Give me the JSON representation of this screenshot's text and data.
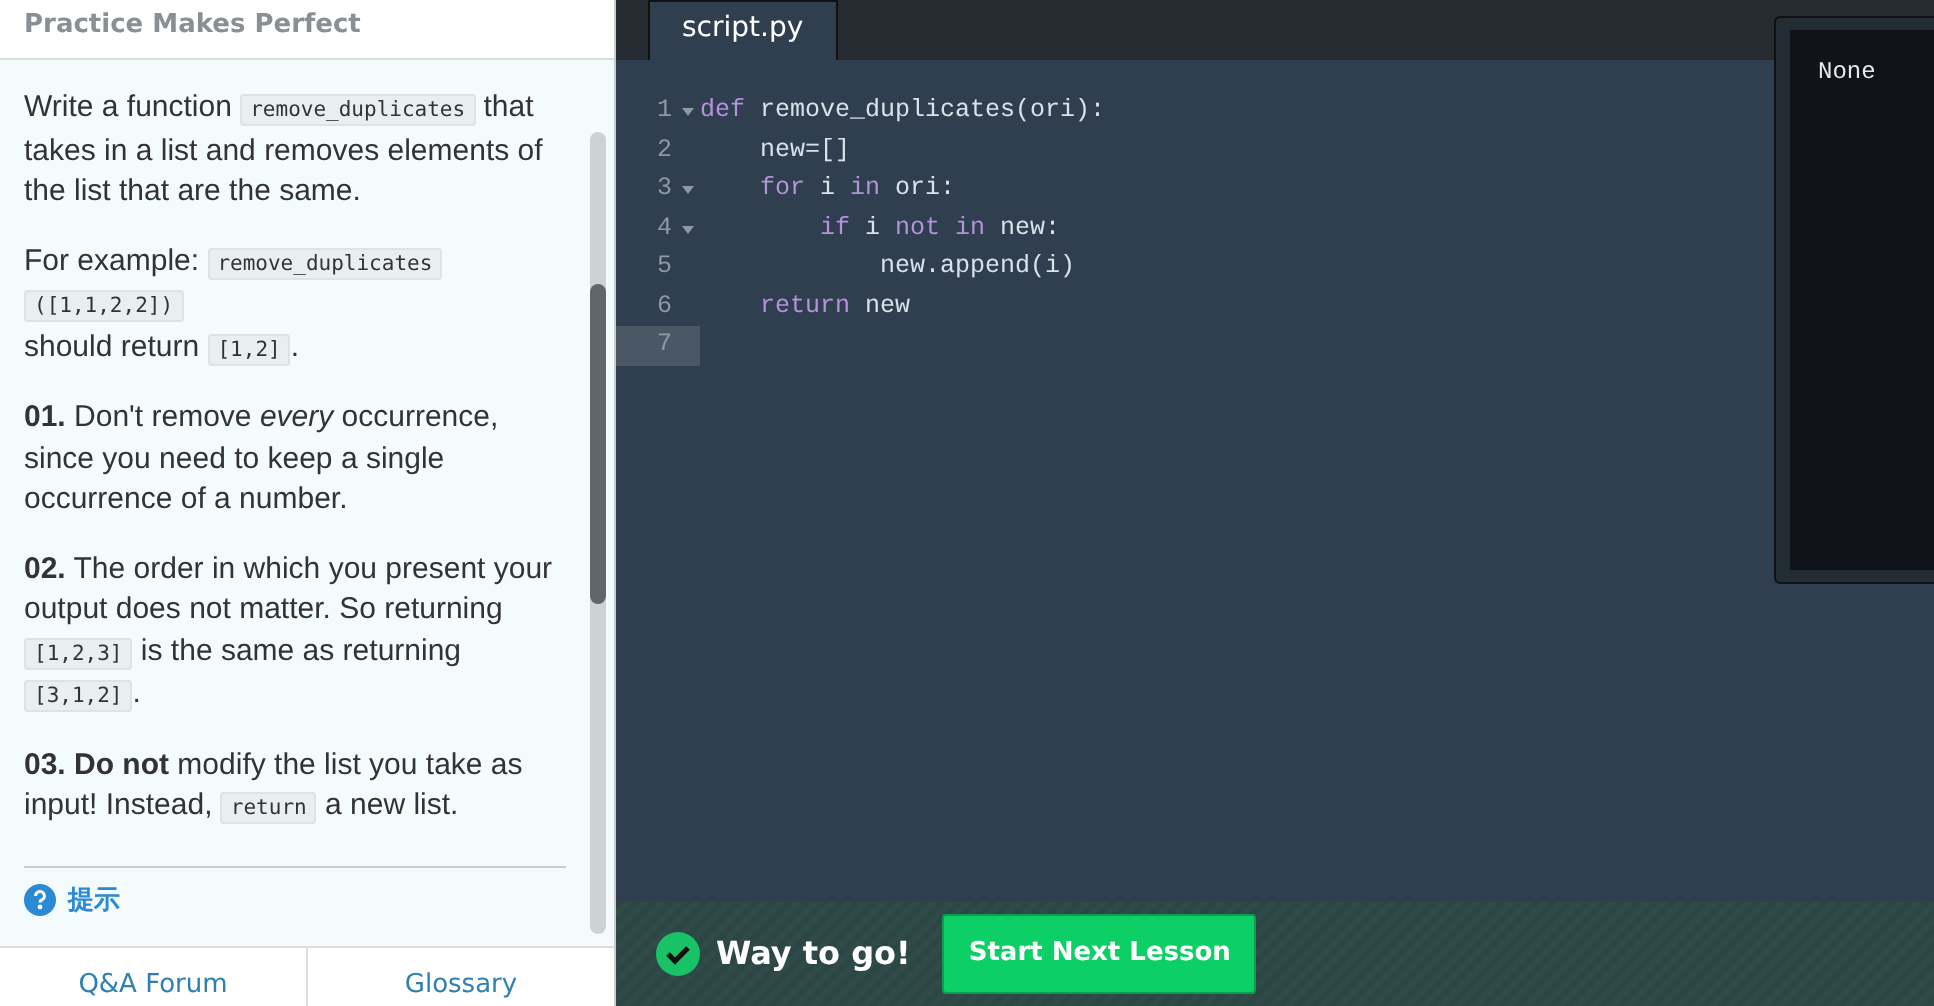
{
  "lesson": {
    "title": "Practice Makes Perfect",
    "paragraphs": [
      [
        {
          "kind": "text",
          "text": "Write a function "
        },
        {
          "kind": "code",
          "text": "remove_duplicates"
        },
        {
          "kind": "text",
          "text": " that takes in a list and removes elements of the list that are the same."
        }
      ],
      [
        {
          "kind": "text",
          "text": "For example: "
        },
        {
          "kind": "code",
          "text": "remove_duplicates"
        },
        {
          "kind": "space"
        },
        {
          "kind": "code",
          "text": "([1,1,2,2])"
        },
        {
          "kind": "break"
        },
        {
          "kind": "text",
          "text": "should return "
        },
        {
          "kind": "code",
          "text": "[1,2]"
        },
        {
          "kind": "text",
          "text": "."
        }
      ],
      [
        {
          "kind": "bold",
          "text": "01."
        },
        {
          "kind": "text",
          "text": " Don't remove "
        },
        {
          "kind": "italic",
          "text": "every"
        },
        {
          "kind": "text",
          "text": " occurrence, since you need to keep a single occurrence of a number."
        }
      ],
      [
        {
          "kind": "bold",
          "text": "02."
        },
        {
          "kind": "text",
          "text": " The order in which you present your output does not matter. So returning "
        },
        {
          "kind": "code",
          "text": "[1,2,3]"
        },
        {
          "kind": "text",
          "text": " is the same as returning "
        },
        {
          "kind": "code",
          "text": "[3,1,2]"
        },
        {
          "kind": "text",
          "text": "."
        }
      ],
      [
        {
          "kind": "bold",
          "text": "03. Do not"
        },
        {
          "kind": "text",
          "text": " modify the list you take as input! Instead, "
        },
        {
          "kind": "code",
          "text": "return"
        },
        {
          "kind": "text",
          "text": " a new list."
        }
      ]
    ],
    "hint": "提示",
    "footer_links": [
      "Q&A Forum",
      "Glossary"
    ]
  },
  "editor": {
    "tabs": [
      {
        "label": "script.py",
        "selected": true
      }
    ],
    "lines": [
      {
        "number": "1",
        "fold": true,
        "current": false,
        "tokens": [
          {
            "kind": "keyword",
            "text": "def"
          },
          {
            "kind": "plain",
            "text": " remove_duplicates(ori):"
          }
        ]
      },
      {
        "number": "2",
        "fold": false,
        "current": false,
        "tokens": [
          {
            "kind": "plain",
            "text": "    new=[]"
          }
        ]
      },
      {
        "number": "3",
        "fold": true,
        "current": false,
        "tokens": [
          {
            "kind": "keyword",
            "text": "    for"
          },
          {
            "kind": "plain",
            "text": " i "
          },
          {
            "kind": "keyword",
            "text": "in"
          },
          {
            "kind": "plain",
            "text": " ori:"
          }
        ]
      },
      {
        "number": "4",
        "fold": true,
        "current": false,
        "tokens": [
          {
            "kind": "keyword",
            "text": "        if"
          },
          {
            "kind": "plain",
            "text": " i "
          },
          {
            "kind": "keyword",
            "text": "not in"
          },
          {
            "kind": "plain",
            "text": " new:"
          }
        ]
      },
      {
        "number": "5",
        "fold": false,
        "current": false,
        "tokens": [
          {
            "kind": "plain",
            "text": "            new.append(i)"
          }
        ]
      },
      {
        "number": "6",
        "fold": false,
        "current": false,
        "tokens": [
          {
            "kind": "keyword",
            "text": "    return"
          },
          {
            "kind": "plain",
            "text": " new"
          }
        ]
      },
      {
        "number": "7",
        "fold": false,
        "current": true
      }
    ]
  },
  "output": {
    "text": "None"
  },
  "status": {
    "message": "Way to go!",
    "button": "Start Next Lesson"
  }
}
